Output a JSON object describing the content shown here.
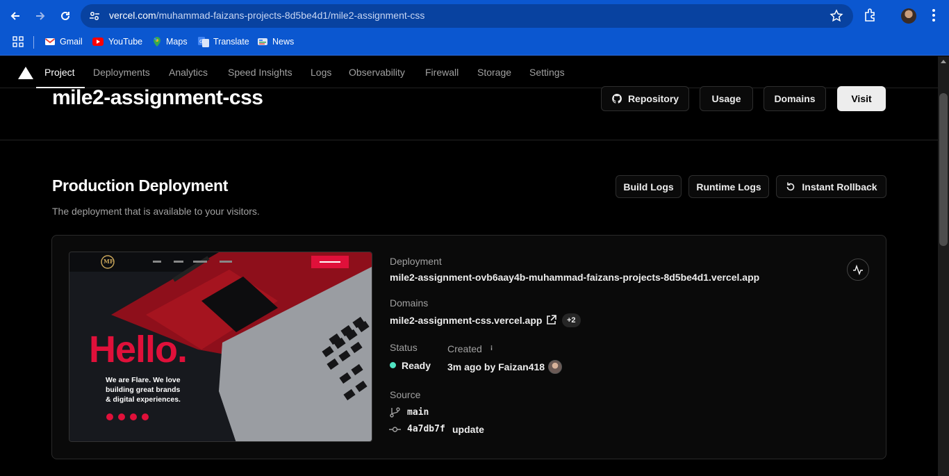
{
  "browser": {
    "url_host": "vercel.com",
    "url_path": "/muhammad-faizans-projects-8d5be4d1/mile2-assignment-css",
    "bookmarks": [
      {
        "label": "Gmail",
        "icon": "gmail-icon",
        "color": "#ea4335"
      },
      {
        "label": "YouTube",
        "icon": "youtube-icon",
        "color": "#ff0000"
      },
      {
        "label": "Maps",
        "icon": "maps-icon",
        "color": "#34a853"
      },
      {
        "label": "Translate",
        "icon": "translate-icon",
        "color": "#4285f4"
      },
      {
        "label": "News",
        "icon": "news-icon",
        "color": "#4285f4"
      }
    ]
  },
  "nav": {
    "tabs": [
      "Project",
      "Deployments",
      "Analytics",
      "Speed Insights",
      "Logs",
      "Observability",
      "Firewall",
      "Storage",
      "Settings"
    ],
    "active": "Project"
  },
  "project": {
    "title": "mile2-assignment-css",
    "buttons": {
      "repository": "Repository",
      "usage": "Usage",
      "domains": "Domains",
      "visit": "Visit"
    }
  },
  "production": {
    "title": "Production Deployment",
    "subtitle": "The deployment that is available to your visitors.",
    "buttons": {
      "build_logs": "Build Logs",
      "runtime_logs": "Runtime Logs",
      "instant_rollback": "Instant Rollback"
    },
    "deployment_label": "Deployment",
    "deployment_url": "mile2-assignment-ovb6aay4b-muhammad-faizans-projects-8d5be4d1.vercel.app",
    "domains_label": "Domains",
    "domain": "mile2-assignment-css.vercel.app",
    "domain_extra": "+2",
    "status_label": "Status",
    "status": "Ready",
    "status_color": "#50e3c2",
    "created_label": "Created",
    "created": "3m ago by Faizan418",
    "source_label": "Source",
    "branch": "main",
    "commit_hash": "4a7db7f",
    "commit_msg": "update"
  },
  "preview": {
    "logo": "MF",
    "hello": "Hello.",
    "tagline_1": "We are Flare. We love",
    "tagline_2": "building great brands",
    "tagline_3": "& digital experiences.",
    "accent": "#e0103a"
  }
}
